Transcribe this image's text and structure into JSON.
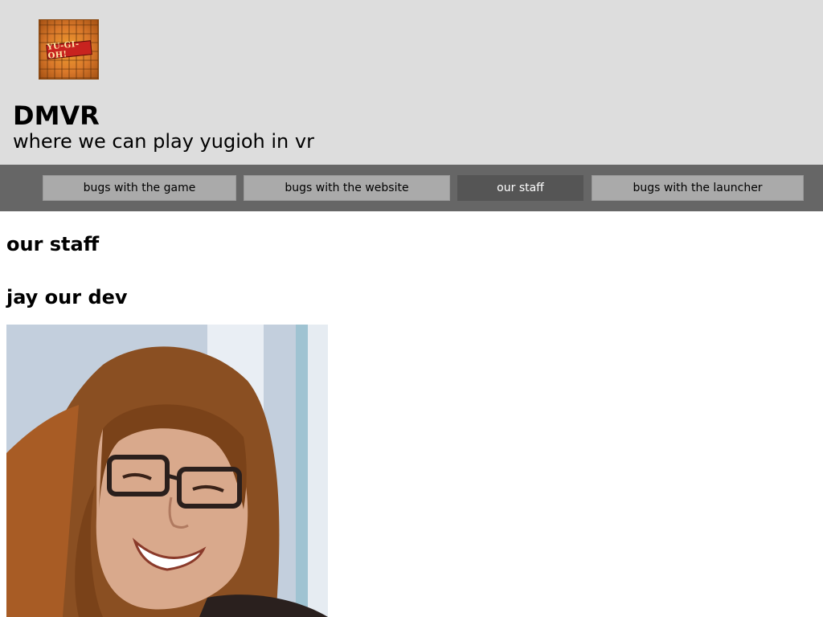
{
  "header": {
    "logo_icon": "yugioh-logo-icon",
    "logo_text": "YU-GI-OH!",
    "title": "DMVR",
    "tagline": "where we can play yugioh in vr"
  },
  "nav": {
    "items": [
      {
        "label": "bugs with the game",
        "active": false
      },
      {
        "label": "bugs with the website",
        "active": false
      },
      {
        "label": "our staff",
        "active": true
      },
      {
        "label": "bugs with the launcher",
        "active": false
      }
    ]
  },
  "main": {
    "heading": "our staff",
    "staff": [
      {
        "name": "jay our dev",
        "photo_icon": "staff-photo"
      }
    ]
  },
  "colors": {
    "header_bg": "#dddddd",
    "nav_bg": "#666666",
    "nav_item_bg": "#aaaaaa",
    "nav_item_active_bg": "#555555"
  }
}
